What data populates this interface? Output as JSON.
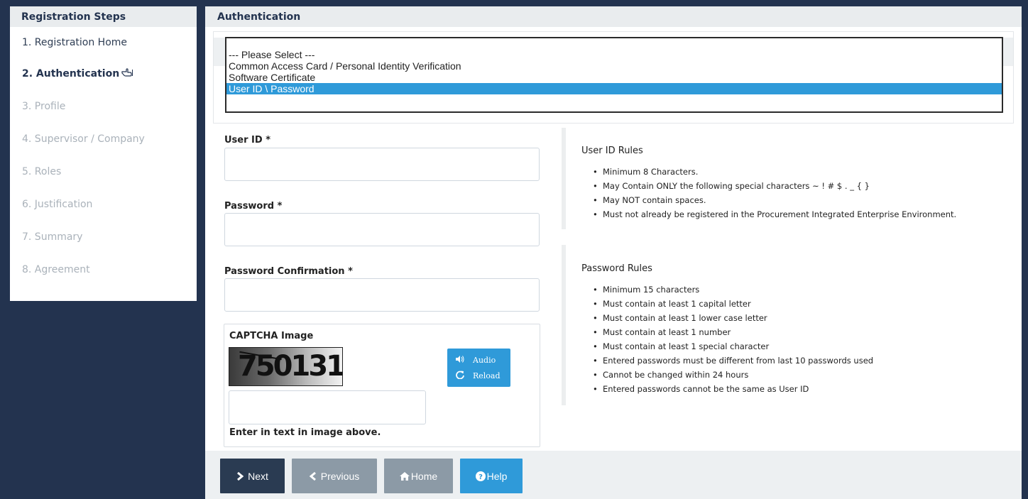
{
  "sidebar": {
    "title": "Registration Steps",
    "steps": [
      {
        "label": "1. Registration Home"
      },
      {
        "label": "2. Authentication"
      },
      {
        "label": "3. Profile"
      },
      {
        "label": "4. Supervisor / Company"
      },
      {
        "label": "5. Roles"
      },
      {
        "label": "6. Justification"
      },
      {
        "label": "7. Summary"
      },
      {
        "label": "8. Agreement"
      }
    ],
    "active_step": 2
  },
  "main": {
    "title": "Authentication",
    "auth_method": {
      "options": [
        "--- Please Select ---",
        "Common Access Card / Personal Identity Verification",
        "Software Certificate",
        "User ID \\ Password"
      ],
      "selected": "User ID \\ Password"
    },
    "fields": {
      "user_id_label": "User ID *",
      "user_id_value": "",
      "password_label": "Password *",
      "password_value": "",
      "password_confirm_label": "Password Confirmation *",
      "password_confirm_value": ""
    },
    "captcha": {
      "title": "CAPTCHA Image",
      "image_text": "750131",
      "audio_label": "Audio",
      "reload_label": "Reload",
      "input_value": "",
      "hint": "Enter in text in image above."
    },
    "user_id_rules": {
      "title": "User ID Rules",
      "items": [
        "Minimum 8 Characters.",
        "May Contain ONLY the following special characters ~ ! # $ . _ { }",
        "May NOT contain spaces.",
        "Must not already be registered in the Procurement Integrated Enterprise Environment."
      ]
    },
    "password_rules": {
      "title": "Password Rules",
      "items": [
        "Minimum 15 characters",
        "Must contain at least 1 capital letter",
        "Must contain at least 1 lower case letter",
        "Must contain at least 1 number",
        "Must contain at least 1 special character",
        "Entered passwords must be different from last 10 passwords used",
        "Cannot be changed within 24 hours",
        "Entered passwords cannot be the same as User ID"
      ]
    }
  },
  "footer": {
    "next_label": "Next",
    "previous_label": "Previous",
    "home_label": "Home",
    "help_label": "Help"
  },
  "colors": {
    "navy": "#23334f",
    "accent_blue": "#2f9ad9",
    "disabled_gray": "#8c9aa6"
  }
}
